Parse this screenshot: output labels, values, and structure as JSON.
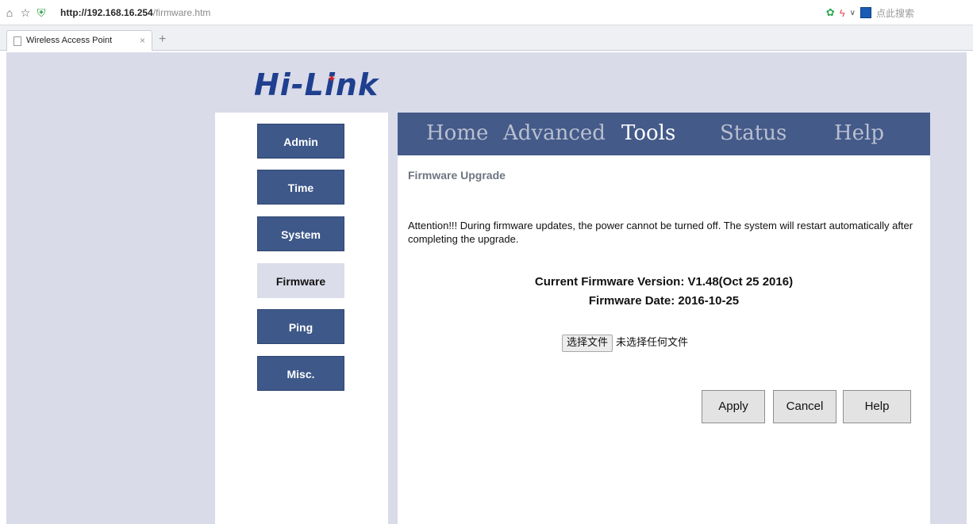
{
  "browser": {
    "url_host": "http://192.168.16.254",
    "url_path": "/firmware.htm",
    "search_placeholder": "点此搜索",
    "tab_title": "Wireless Access Point",
    "tab_close": "×",
    "new_tab": "+"
  },
  "brand": {
    "logo_text": "Hi-Link"
  },
  "sidebar": {
    "items": [
      {
        "label": "Admin"
      },
      {
        "label": "Time"
      },
      {
        "label": "System"
      },
      {
        "label": "Firmware",
        "active": true
      },
      {
        "label": "Ping"
      },
      {
        "label": "Misc."
      }
    ]
  },
  "topnav": {
    "items": [
      {
        "label": "Home"
      },
      {
        "label": "Advanced"
      },
      {
        "label": "Tools",
        "active": true
      },
      {
        "label": "Status"
      },
      {
        "label": "Help"
      }
    ]
  },
  "main": {
    "section_title": "Firmware Upgrade",
    "attention_text": "Attention!!! During firmware updates, the power cannot be turned off. The system will restart automatically after completing the upgrade.",
    "firmware_version": "Current Firmware Version: V1.48(Oct 25 2016)",
    "firmware_date": "Firmware Date: 2016-10-25",
    "file_button": "选择文件",
    "file_status": "未选择任何文件",
    "apply_label": "Apply",
    "cancel_label": "Cancel",
    "help_label": "Help"
  },
  "colors": {
    "nav_bg": "#445a89",
    "sidebar_button": "#3e5889",
    "active_sidebar": "#dcddea",
    "page_bg": "#d9dbe9",
    "logo": "#1f3f8f"
  }
}
